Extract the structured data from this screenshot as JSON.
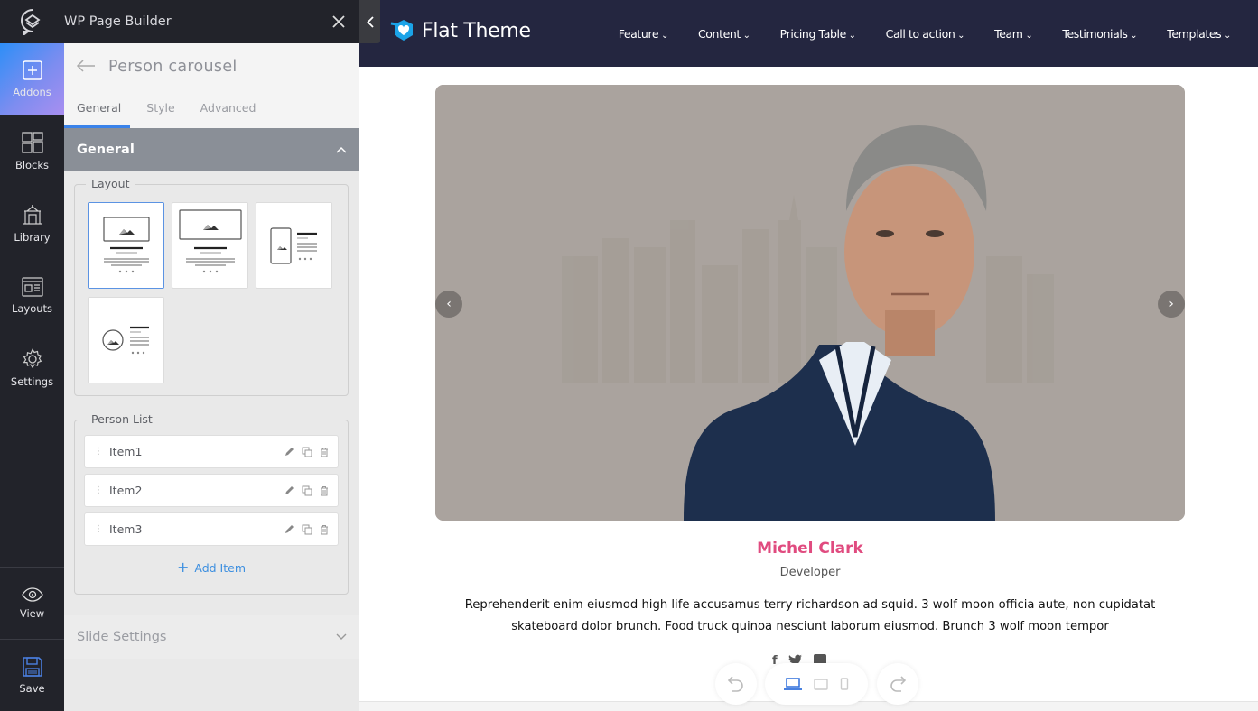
{
  "builder": {
    "app_title": "WP Page Builder",
    "rail": [
      {
        "label": "Addons",
        "icon": "plus-square-icon",
        "active": true
      },
      {
        "label": "Blocks",
        "icon": "blocks-grid-icon"
      },
      {
        "label": "Library",
        "icon": "library-building-icon"
      },
      {
        "label": "Layouts",
        "icon": "layout-icon"
      },
      {
        "label": "Settings",
        "icon": "gear-icon"
      }
    ],
    "rail_bottom": [
      {
        "label": "View",
        "icon": "eye-icon"
      },
      {
        "label": "Save",
        "icon": "floppy-disk-icon"
      }
    ],
    "panel": {
      "title": "Person carousel",
      "tabs": [
        "General",
        "Style",
        "Advanced"
      ],
      "active_tab": "General",
      "section_title": "General",
      "layout_label": "Layout",
      "layouts": [
        "layout-1",
        "layout-2",
        "layout-3",
        "layout-4"
      ],
      "selected_layout": "layout-1",
      "person_list_label": "Person List",
      "items": [
        "Item1",
        "Item2",
        "Item3"
      ],
      "add_item_label": "Add Item",
      "slide_settings_label": "Slide Settings"
    }
  },
  "site": {
    "brand": "Flat Theme",
    "menu": [
      "Feature",
      "Content",
      "Pricing Table",
      "Call to action",
      "Team",
      "Testimonials",
      "Templates"
    ],
    "person": {
      "name": "Michel Clark",
      "role": "Developer",
      "description": "Reprehenderit enim eiusmod high life accusamus terry richardson ad squid. 3 wolf moon officia aute, non cupidatat skateboard dolor brunch. Food truck quinoa nesciunt laborum eiusmod. Brunch 3 wolf moon tempor",
      "social": [
        "facebook-icon",
        "twitter-icon",
        "linkedin-icon"
      ]
    },
    "carousel": {
      "prev": "‹",
      "next": "›"
    }
  },
  "colors": {
    "accent": "#3a83ea",
    "name_pink": "#e04b7f",
    "nav_bg": "#242640",
    "rail_bg": "#22232a"
  },
  "device_toolbar": {
    "devices": [
      "desktop",
      "tablet",
      "mobile"
    ],
    "active": "desktop"
  }
}
